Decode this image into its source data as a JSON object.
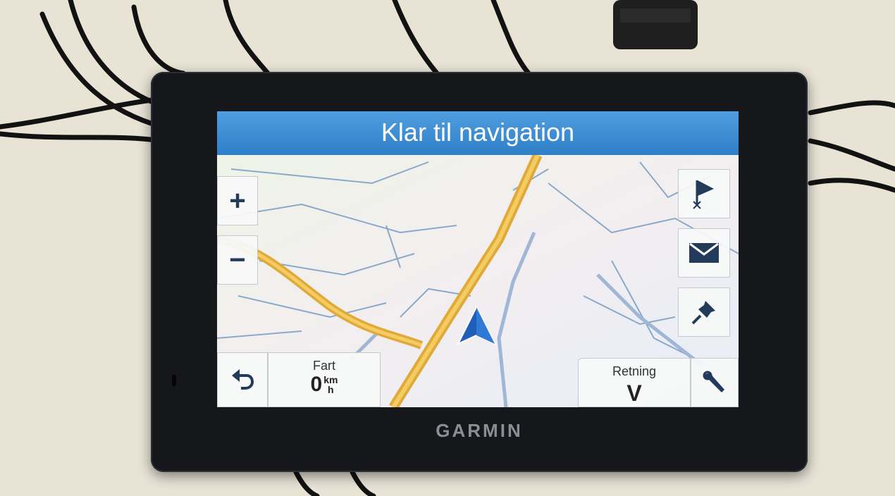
{
  "screen": {
    "title": "Klar til navigation"
  },
  "map_controls": {
    "zoom_in_label": "+",
    "zoom_out_label": "−"
  },
  "side_buttons": [
    {
      "icon": "flag-icon",
      "name": "stop-route-button"
    },
    {
      "icon": "envelope-icon",
      "name": "messages-button"
    },
    {
      "icon": "pushpin-icon",
      "name": "save-location-button"
    }
  ],
  "status": {
    "speed_label": "Fart",
    "speed_value": "0",
    "speed_unit_top": "km",
    "speed_unit_bottom": "h",
    "heading_label": "Retning",
    "heading_value": "V"
  },
  "device": {
    "brand": "GARMIN"
  },
  "colors": {
    "title_bar": "#3b8fd8",
    "main_road": "#e0aa3a",
    "position_arrow": "#1f5fb8"
  }
}
